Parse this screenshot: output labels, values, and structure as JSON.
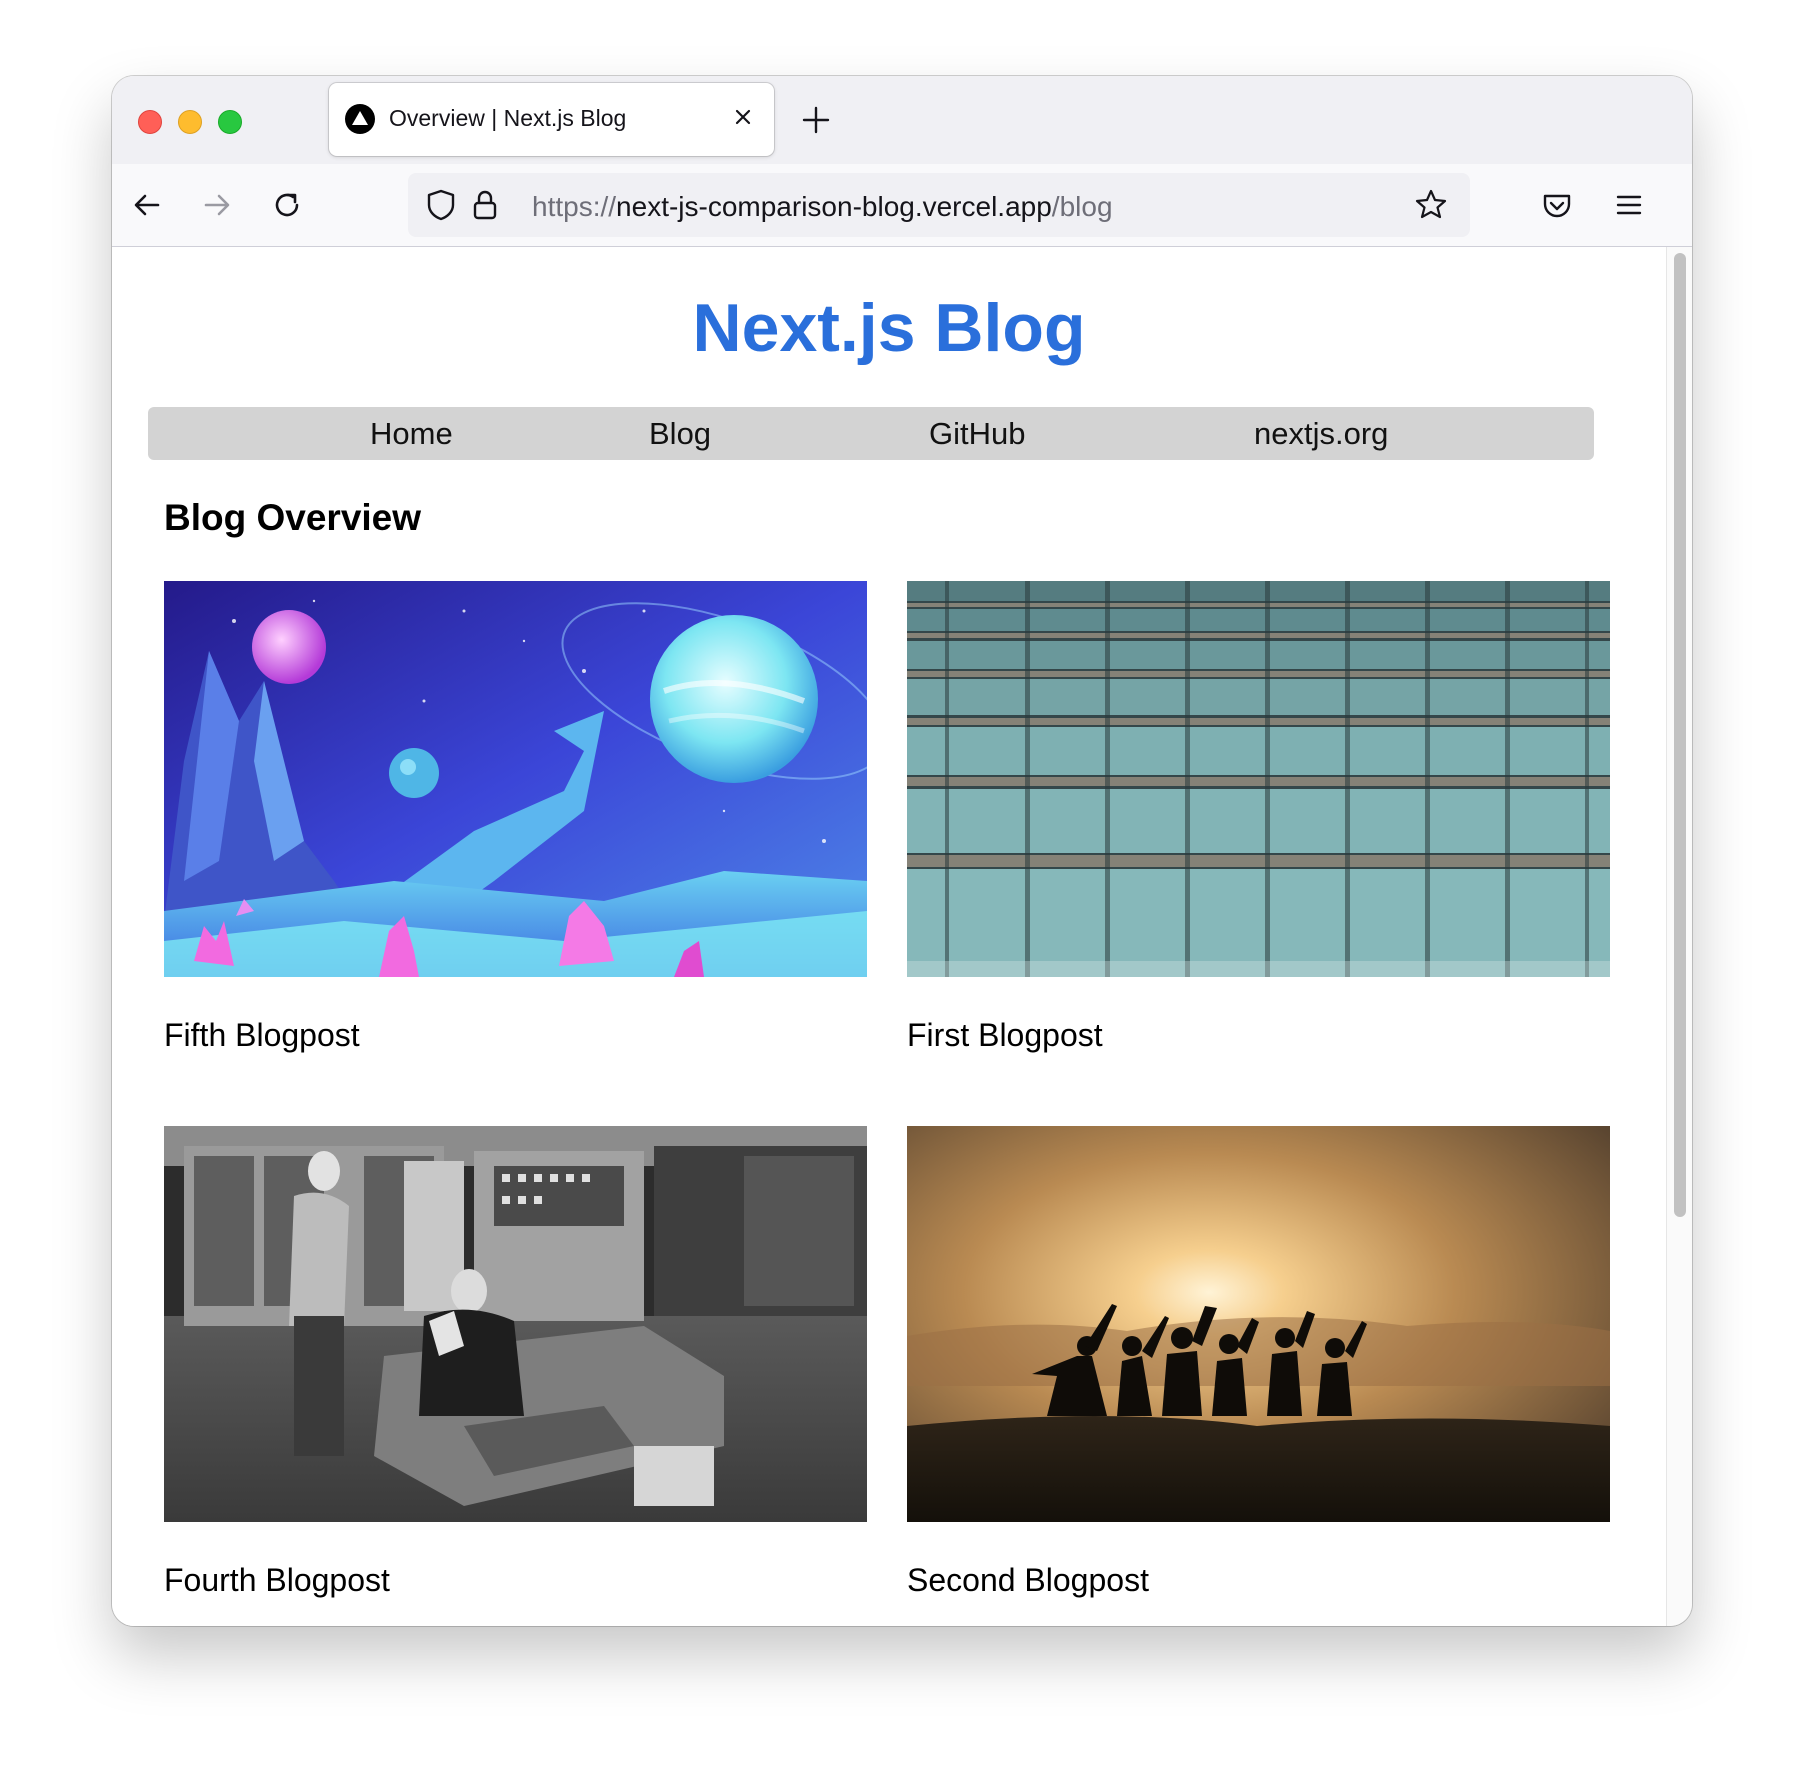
{
  "browser": {
    "tab_title": "Overview | Next.js Blog",
    "url_scheme": "https://",
    "url_host": "next-js-comparison-blog.vercel.app",
    "url_path": "/blog"
  },
  "site": {
    "title": "Next.js Blog",
    "nav": [
      "Home",
      "Blog",
      "GitHub",
      "nextjs.org"
    ]
  },
  "page": {
    "heading": "Blog Overview",
    "posts": [
      {
        "title": "Fifth Blogpost",
        "image": "space-planet-illustration"
      },
      {
        "title": "First Blogpost",
        "image": "stadium-seats-photo"
      },
      {
        "title": "Fourth Blogpost",
        "image": "vintage-computer-photo"
      },
      {
        "title": "Second Blogpost",
        "image": "sunset-silhouettes-photo"
      }
    ]
  },
  "icons": {
    "back": "arrow-left-icon",
    "forward": "arrow-right-icon",
    "reload": "reload-icon",
    "shield": "shield-icon",
    "lock": "lock-icon",
    "bookmark": "star-icon",
    "pocket": "pocket-icon",
    "menu": "hamburger-menu-icon"
  },
  "colors": {
    "site_title": "#2a6fdb",
    "nav_background": "#d3d3d3"
  }
}
